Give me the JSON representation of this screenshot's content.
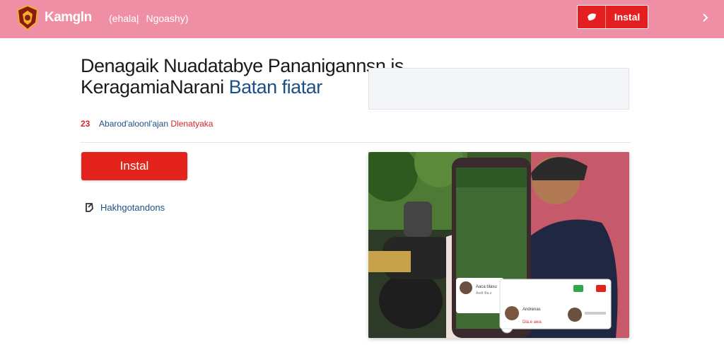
{
  "header": {
    "brand": "Kamgln",
    "nav": [
      "(ehala|",
      "Ngoashy)"
    ],
    "install_label": "Instal"
  },
  "hero": {
    "title_line1": "Denagaik Nuadatabye Pananigannsn is",
    "title_line2a": "KeragamiaNarani",
    "title_line2b": "Batan fiatar",
    "meta_number": "23",
    "meta_text_a": "Abarod'aloonl'ajan",
    "meta_text_b": "Dlenatyaka",
    "install_label": "Instal",
    "link_label": "Hakhgotandons"
  },
  "photo": {
    "card_title": "Aaca blasu",
    "card_sub": "Aedt l9a.s",
    "call_label": "Andrenas",
    "call_sub": "Dla.e awa"
  },
  "colors": {
    "header_bg": "#ef8fa6",
    "accent_red": "#e3231c",
    "link_blue": "#1d4f87"
  },
  "icons": {
    "logo": "garuda-emblem-icon",
    "install": "shield-icon",
    "chevron": "chevron-right-icon",
    "link": "external-link-icon"
  }
}
